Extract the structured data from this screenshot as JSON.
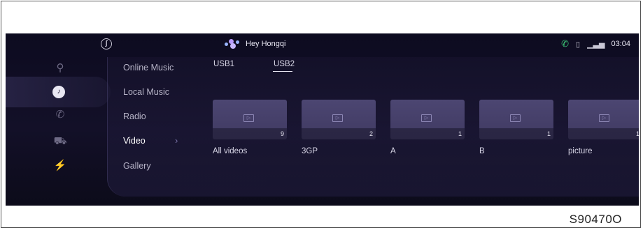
{
  "status_bar": {
    "assistant_text": "Hey Hongqi",
    "time": "03:04",
    "icons": [
      "logo-icon",
      "assistant-icon",
      "phone-icon",
      "battery-icon",
      "signal-icon"
    ]
  },
  "rail": {
    "items": [
      {
        "name": "navigation-icon",
        "glyph": "⚲"
      },
      {
        "name": "media-icon",
        "glyph": "♪"
      },
      {
        "name": "phone-icon",
        "glyph": "✆"
      },
      {
        "name": "car-icon",
        "glyph": "⛟"
      },
      {
        "name": "charging-icon",
        "glyph": "⚡"
      }
    ],
    "active_index": 1
  },
  "menu": {
    "items": [
      "Online Music",
      "Local Music",
      "Radio",
      "Video",
      "Gallery"
    ],
    "active": "Video"
  },
  "tabs": {
    "items": [
      "USB1",
      "USB2"
    ],
    "active": "USB2"
  },
  "videos": [
    {
      "label": "All videos",
      "count": "9"
    },
    {
      "label": "3GP",
      "count": "2"
    },
    {
      "label": "A",
      "count": "1"
    },
    {
      "label": "B",
      "count": "1"
    },
    {
      "label": "picture",
      "count": "1"
    }
  ],
  "figure_code": "S90470O",
  "colors": {
    "background": "#0d0b20",
    "tile": "#4c4672",
    "accent_green": "#3fd07a"
  }
}
